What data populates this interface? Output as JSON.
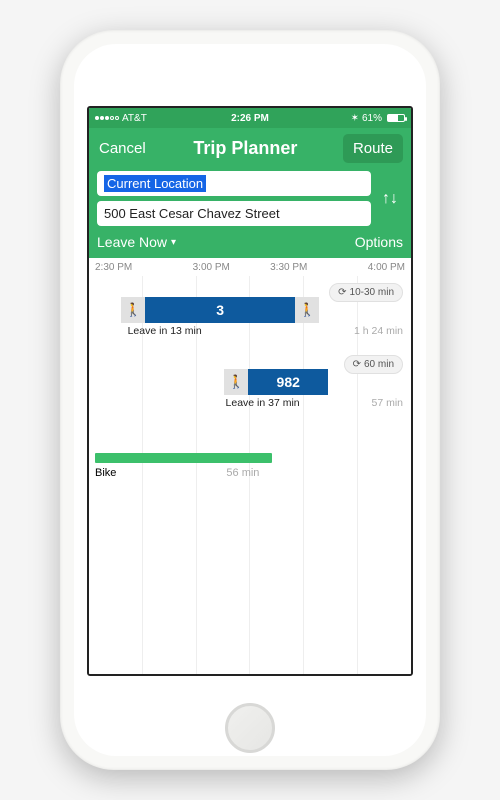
{
  "status": {
    "carrier": "AT&T",
    "time": "2:26 PM",
    "battery_pct": "61%"
  },
  "header": {
    "cancel": "Cancel",
    "title": "Trip Planner",
    "route": "Route",
    "from": "Current Location",
    "to": "500 East Cesar Chavez Street",
    "leave": "Leave Now",
    "options": "Options"
  },
  "timeline": {
    "ticks": [
      "2:30 PM",
      "3:00 PM",
      "3:30 PM",
      "4:00 PM"
    ]
  },
  "routes": [
    {
      "frequency": "10-30 min",
      "bus_label": "3",
      "leave_text": "Leave in 13 min",
      "duration": "1 h 24 min",
      "bar_left_pct": 10,
      "walk1_w": 24,
      "bus_w": 150,
      "walk2_w": 24
    },
    {
      "frequency": "60 min",
      "bus_label": "982",
      "leave_text": "Leave in 37 min",
      "duration": "57 min",
      "bar_left_pct": 42,
      "walk1_w": 24,
      "bus_w": 80,
      "walk2_w": 0
    }
  ],
  "bike": {
    "label": "Bike",
    "duration": "56 min",
    "width_pct": 55
  }
}
